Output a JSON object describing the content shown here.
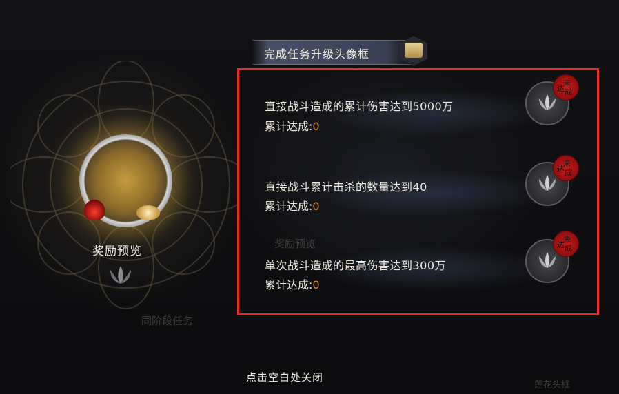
{
  "left_panel": {
    "reward_preview_label": "奖励预览",
    "faded_labels": [
      "奖励预览",
      "同阶段任务"
    ]
  },
  "header": {
    "title": "完成任务升级头像框",
    "badge_icon": "scroll-chest-icon"
  },
  "tasks": [
    {
      "description": "直接战斗造成的累计伤害达到5000万",
      "progress_label": "累计达成:",
      "progress_value": "0",
      "status_stamp": [
        "未",
        "达",
        "成"
      ],
      "reward_icon": "lotus-icon"
    },
    {
      "description": "直接战斗累计击杀的数量达到40",
      "progress_label": "累计达成:",
      "progress_value": "0",
      "status_stamp": [
        "未",
        "达",
        "成"
      ],
      "reward_icon": "lotus-icon"
    },
    {
      "description": "单次战斗造成的最高伤害达到300万",
      "progress_label": "累计达成:",
      "progress_value": "0",
      "status_stamp": [
        "未",
        "达",
        "成"
      ],
      "reward_icon": "lotus-icon"
    }
  ],
  "footer": {
    "close_hint": "点击空白处关闭",
    "corner_faded": "莲花头框"
  },
  "colors": {
    "highlight_border": "#ec2a2a",
    "progress_value": "#e08a2c",
    "stamp_red": "#c41a1a"
  }
}
